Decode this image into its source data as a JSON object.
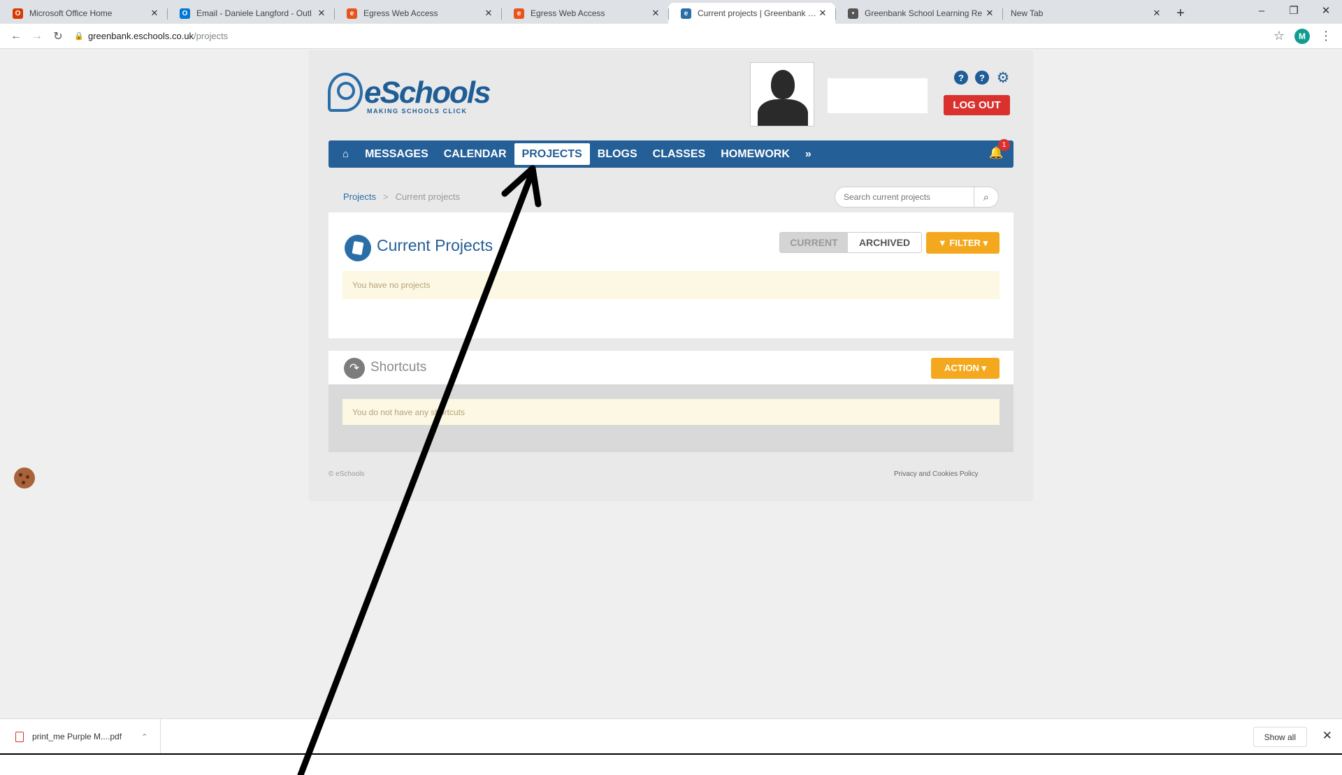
{
  "browser": {
    "tabs": [
      {
        "title": "Microsoft Office Home",
        "favicon_color": "#d83b01",
        "favicon_glyph": "O"
      },
      {
        "title": "Email - Daniele Langford - Outl",
        "favicon_color": "#0078d4",
        "favicon_glyph": "O"
      },
      {
        "title": "Egress Web Access",
        "favicon_color": "#e8541e",
        "favicon_glyph": "e"
      },
      {
        "title": "Egress Web Access",
        "favicon_color": "#e8541e",
        "favicon_glyph": "e"
      },
      {
        "title": "Current projects | Greenbank Sch",
        "favicon_color": "#2a6ea8",
        "favicon_glyph": "e",
        "active": true
      },
      {
        "title": "Greenbank School Learning Re",
        "favicon_color": "#555555",
        "favicon_glyph": "•"
      },
      {
        "title": "New Tab",
        "favicon_color": "",
        "favicon_glyph": ""
      }
    ],
    "url_host": "greenbank.eschools.co.uk",
    "url_path": "/projects",
    "profile_initial": "M"
  },
  "header": {
    "logo_text": "eSchools",
    "logo_tagline": "MAKING SCHOOLS CLICK",
    "logout_label": "LOG OUT"
  },
  "nav": {
    "items": [
      "MESSAGES",
      "CALENDAR",
      "PROJECTS",
      "BLOGS",
      "CLASSES",
      "HOMEWORK"
    ],
    "active": "PROJECTS",
    "notification_count": "1"
  },
  "breadcrumb": {
    "root": "Projects",
    "current": "Current projects"
  },
  "search": {
    "placeholder": "Search current projects"
  },
  "projects": {
    "title": "Current Projects",
    "toggle_current": "CURRENT",
    "toggle_archived": "ARCHIVED",
    "filter_label": "FILTER",
    "empty_message": "You have no projects"
  },
  "shortcuts": {
    "title": "Shortcuts",
    "action_label": "ACTION",
    "empty_message": "You do not have any shortcuts"
  },
  "footer": {
    "copyright": "© eSchools",
    "privacy": "Privacy and Cookies Policy"
  },
  "download_shelf": {
    "file_name": "print_me Purple M....pdf",
    "show_all": "Show all"
  },
  "colors": {
    "brand_blue": "#245f97",
    "logout_red": "#d9322e",
    "action_orange": "#f4a81d",
    "alert_bg": "#fcf8e3",
    "annotation_arrow": "#000000"
  }
}
